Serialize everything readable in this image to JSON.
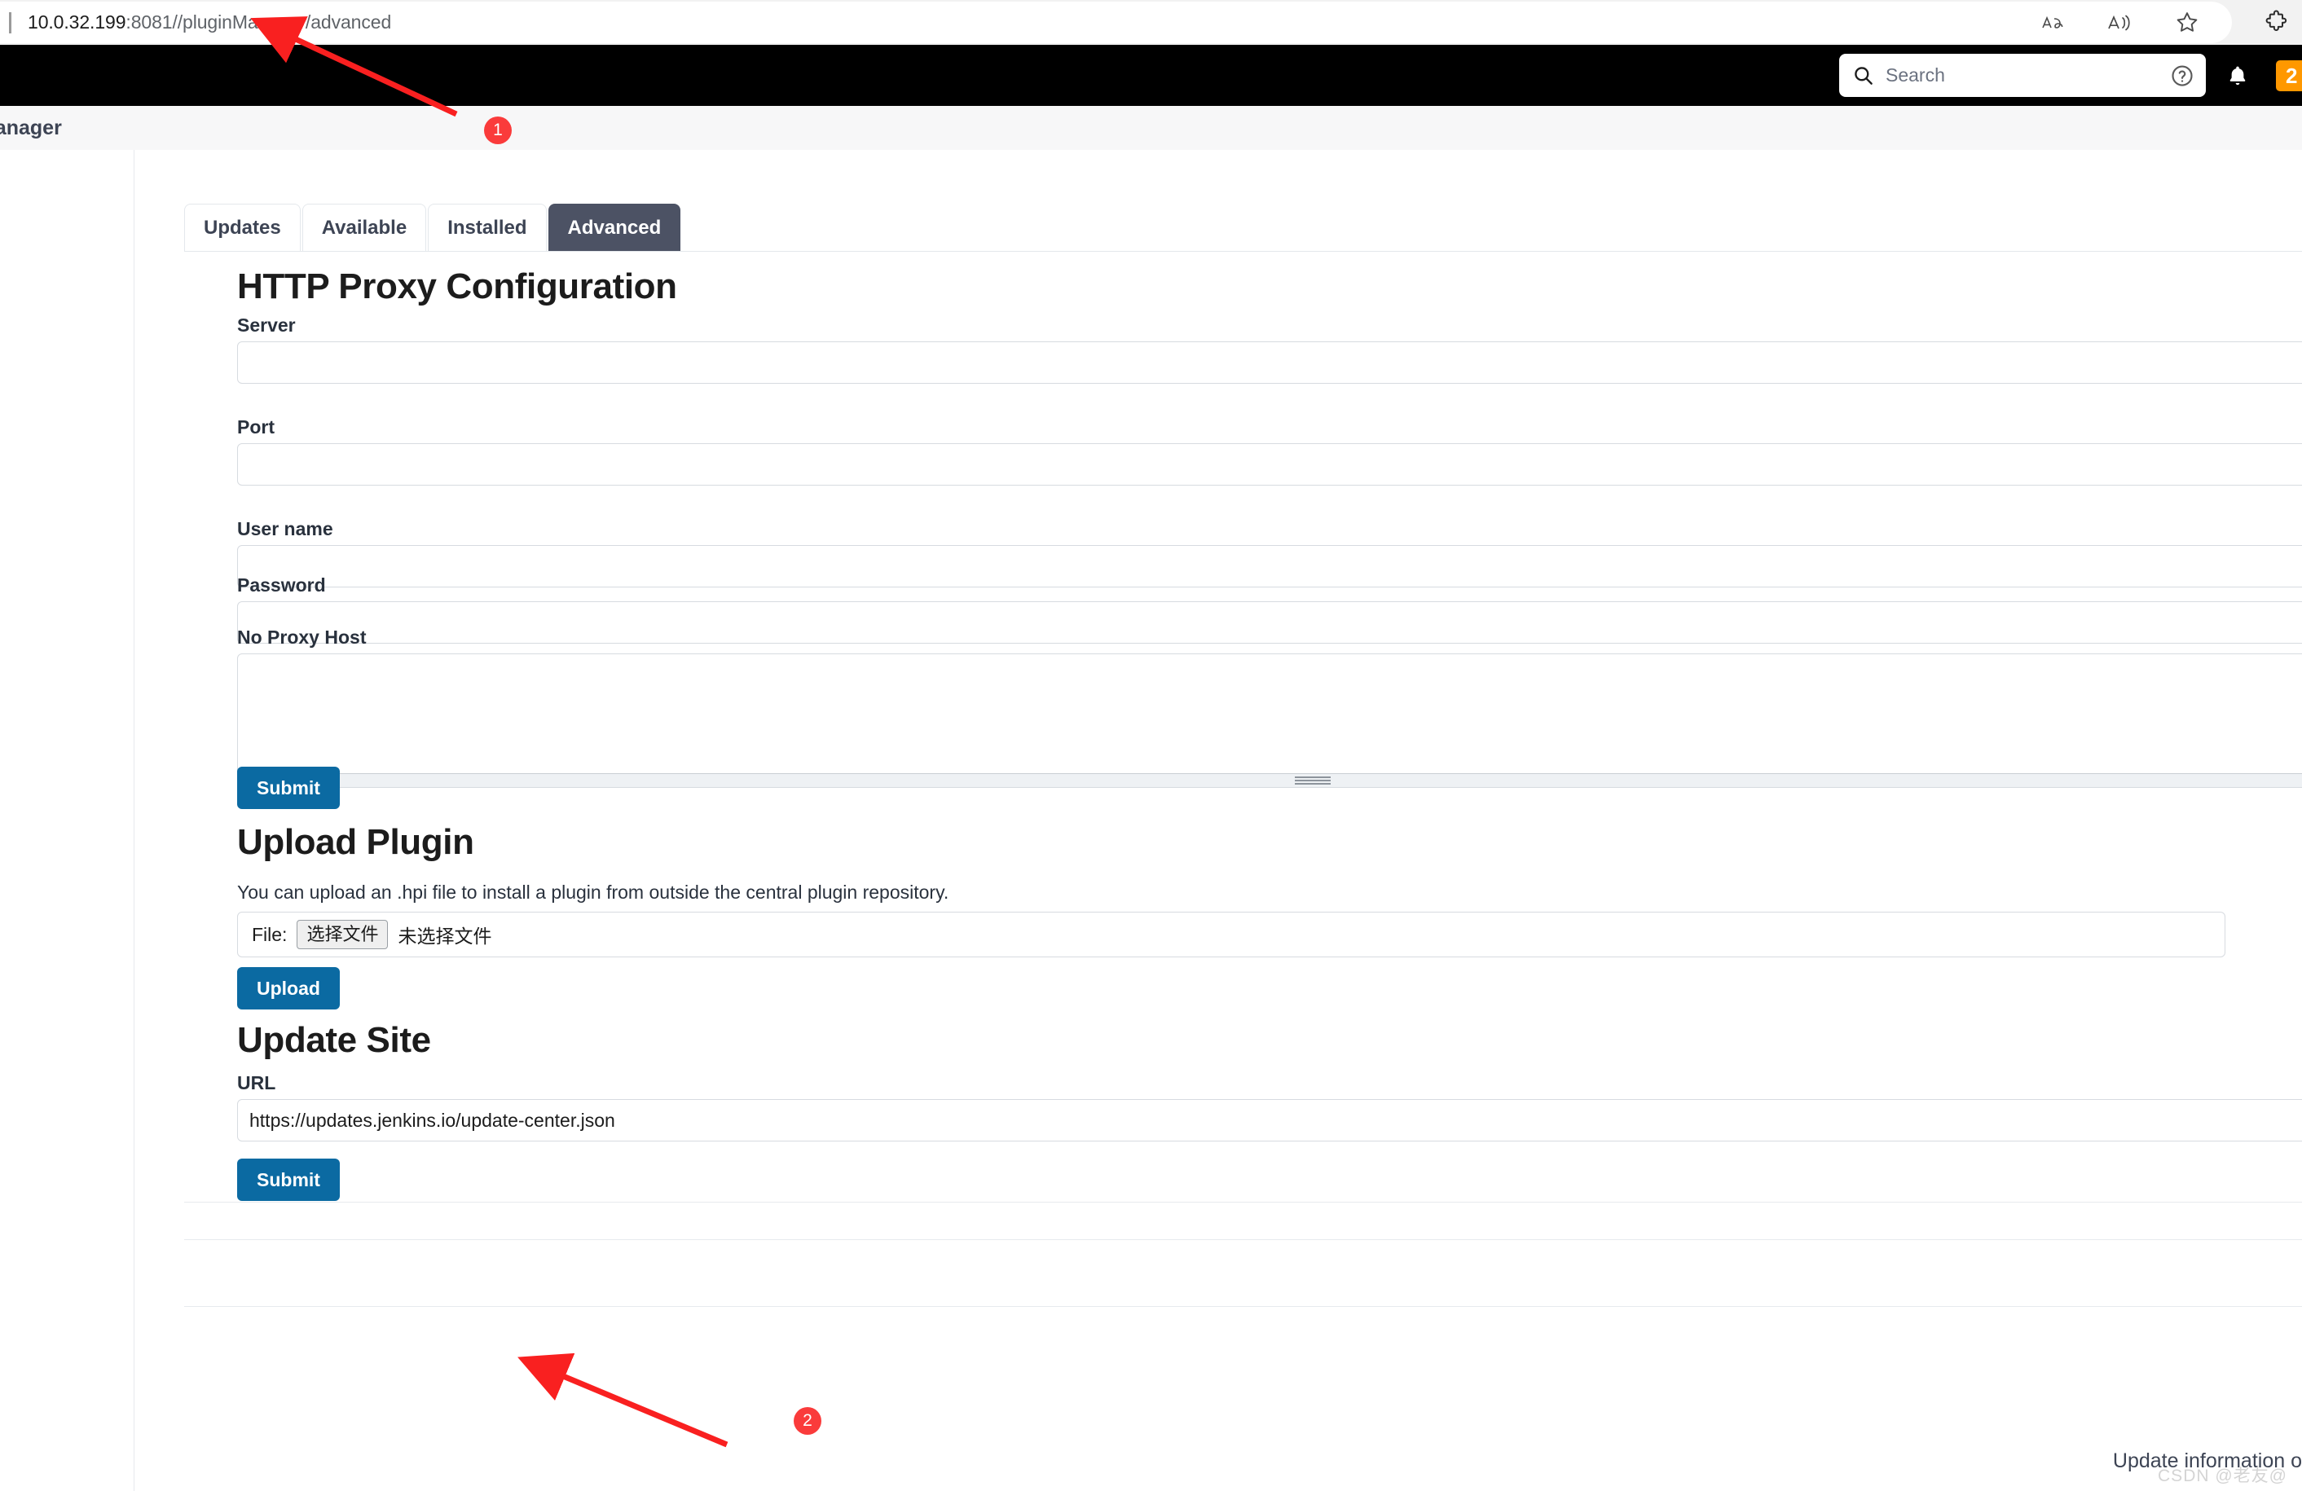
{
  "browser": {
    "url_host": "10.0.32.199",
    "url_rest": ":8081//pluginManager/advanced",
    "icons": {
      "translate": "translate-icon",
      "read_aloud": "read-aloud-icon",
      "favorite": "favorite-star-icon",
      "extension": "extension-puzzle-icon"
    }
  },
  "header": {
    "search_placeholder": "Search",
    "search_value": "",
    "search_icon": "search-icon",
    "help_icon": "help-circle-icon",
    "bell_icon": "notification-bell-icon",
    "badge_count": "2"
  },
  "breadcrumb": {
    "text": "Manager"
  },
  "tabs": [
    {
      "label": "Updates",
      "active": false
    },
    {
      "label": "Available",
      "active": false
    },
    {
      "label": "Installed",
      "active": false
    },
    {
      "label": "Advanced",
      "active": true
    }
  ],
  "proxy": {
    "heading": "HTTP Proxy Configuration",
    "fields": [
      {
        "label": "Server",
        "value": ""
      },
      {
        "label": "Port",
        "value": ""
      },
      {
        "label": "User name",
        "value": ""
      },
      {
        "label": "Password",
        "value": ""
      }
    ],
    "no_proxy_label": "No Proxy Host",
    "no_proxy_value": "",
    "submit_label": "Submit"
  },
  "upload": {
    "heading": "Upload Plugin",
    "description": "You can upload an .hpi file to install a plugin from outside the central plugin repository.",
    "file_label": "File:",
    "file_button": "选择文件",
    "file_status": "未选择文件",
    "upload_label": "Upload"
  },
  "update_site": {
    "heading": "Update Site",
    "url_label": "URL",
    "url_value": "https://updates.jenkins.io/update-center.json",
    "submit_label": "Submit"
  },
  "footer": {
    "note": "Update information o",
    "watermark": "CSDN @老友@"
  },
  "annotations": [
    {
      "id": "1",
      "label": "1"
    },
    {
      "id": "2",
      "label": "2"
    }
  ],
  "colors": {
    "accent_blue": "#0b6aa2",
    "active_tab": "#4c5264",
    "badge_orange": "#ff9800",
    "annotation_red": "#fa3b3b"
  }
}
